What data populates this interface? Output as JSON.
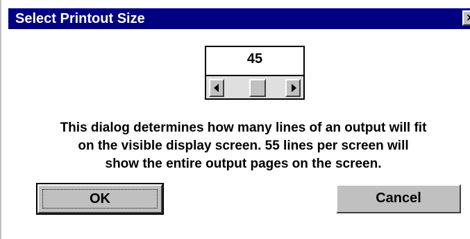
{
  "window": {
    "title": "Select Printout Size",
    "close_glyph": "×",
    "titlebar_color": "#000080",
    "face_color": "#c0c0c0"
  },
  "lines_per_screen": {
    "value": "45",
    "scroll_position_fraction": 0.55
  },
  "message": {
    "line1": "This dialog determines how many lines of an output will fit",
    "line2": "on the visible display screen.  55 lines per screen will",
    "line3": "show the entire output pages on the screen."
  },
  "buttons": {
    "ok_label": "OK",
    "cancel_label": "Cancel"
  },
  "icons": {
    "close": "close-icon",
    "scroll_left": "arrow-left-icon",
    "scroll_right": "arrow-right-icon"
  }
}
